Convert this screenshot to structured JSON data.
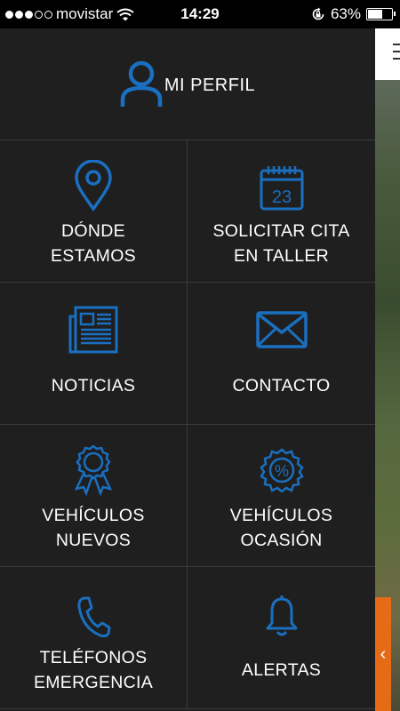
{
  "status_bar": {
    "carrier": "movistar",
    "time": "14:29",
    "battery": "63%",
    "battery_level": 0.63,
    "signal_bars_filled": 3,
    "signal_bars_total": 5
  },
  "menu": {
    "profile_label": "MI PERFIL",
    "accent_color": "#1a6fc0",
    "items": [
      {
        "label": "DÓNDE\nESTAMOS",
        "icon": "map-pin-icon"
      },
      {
        "label": "SOLICITAR CITA\nEN TALLER",
        "icon": "calendar-icon",
        "icon_text": "23"
      },
      {
        "label": "NOTICIAS",
        "icon": "newspaper-icon"
      },
      {
        "label": "CONTACTO",
        "icon": "envelope-icon"
      },
      {
        "label": "VEHÍCULOS\nNUEVOS",
        "icon": "award-ribbon-icon"
      },
      {
        "label": "VEHÍCULOS\nOCASIÓN",
        "icon": "discount-badge-icon",
        "icon_text": "%"
      },
      {
        "label": "TELÉFONOS\nEMERGENCIA",
        "icon": "phone-icon"
      },
      {
        "label": "ALERTAS",
        "icon": "bell-icon"
      }
    ]
  },
  "main_view": {
    "menu_icon": "hamburger-icon",
    "side_tab_icon": "chevron-left-icon",
    "side_tab_color": "#e56b16"
  }
}
